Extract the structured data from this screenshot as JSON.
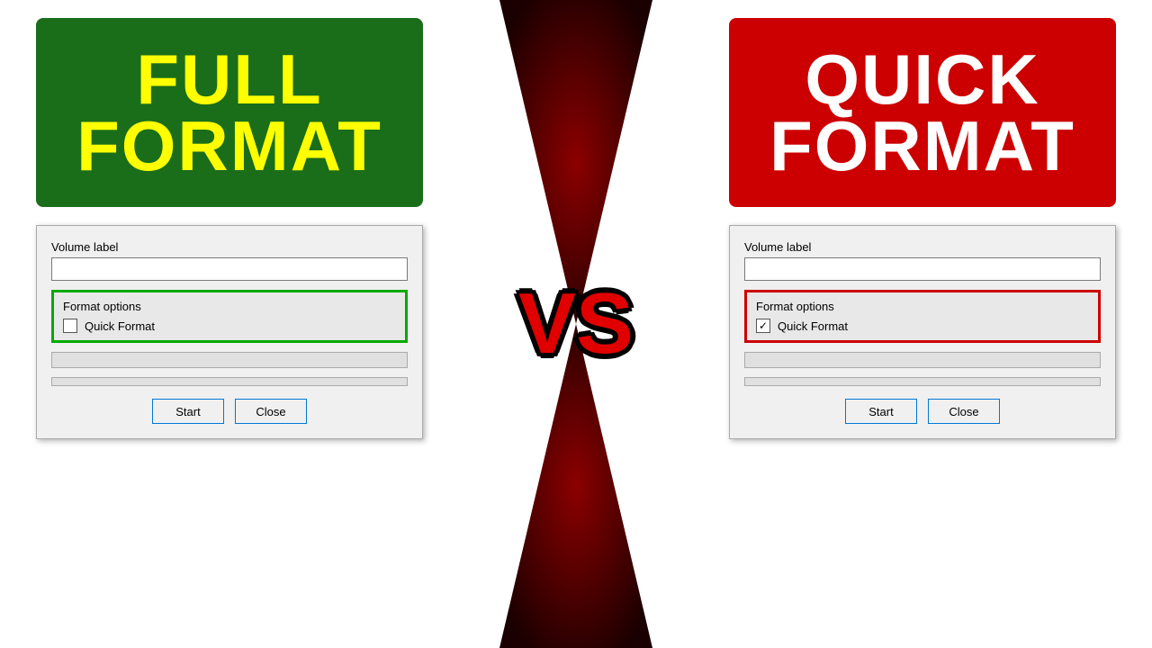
{
  "left": {
    "banner_line1": "FULL",
    "banner_line2": "FORMAT",
    "dialog": {
      "volume_label_text": "Volume label",
      "volume_label_value": "",
      "format_options_title": "Format options",
      "quick_format_label": "Quick Format",
      "quick_format_checked": false,
      "start_button": "Start",
      "close_button": "Close"
    }
  },
  "right": {
    "banner_line1": "QUICK",
    "banner_line2": "FORMAT",
    "dialog": {
      "volume_label_text": "Volume label",
      "volume_label_value": "",
      "format_options_title": "Format options",
      "quick_format_label": "Quick Format",
      "quick_format_checked": true,
      "start_button": "Start",
      "close_button": "Close"
    }
  },
  "vs_text": "VS"
}
